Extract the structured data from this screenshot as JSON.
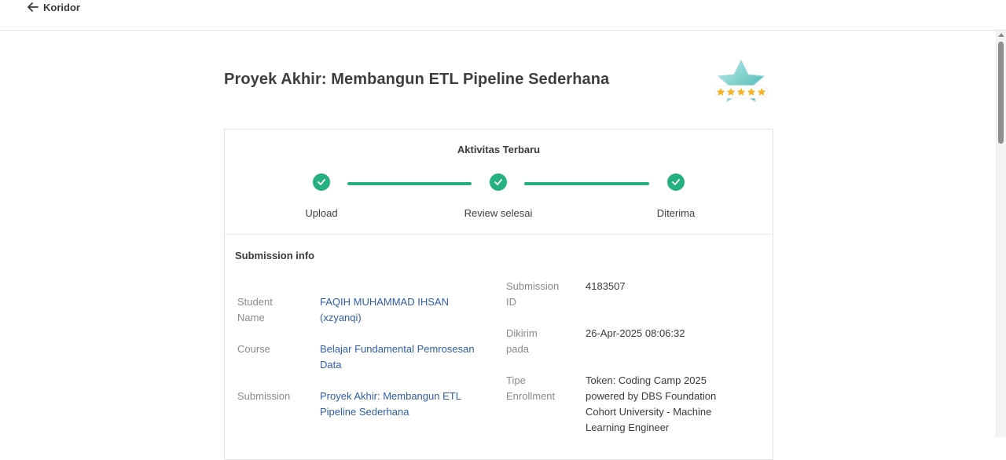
{
  "header": {
    "back_label": "Koridor"
  },
  "page": {
    "title": "Proyek Akhir: Membangun ETL Pipeline Sederhana"
  },
  "activity": {
    "title": "Aktivitas Terbaru",
    "steps": [
      {
        "label": "Upload",
        "status": "completed"
      },
      {
        "label": "Review selesai",
        "status": "completed"
      },
      {
        "label": "Diterima",
        "status": "completed"
      }
    ]
  },
  "submission_info": {
    "title": "Submission info",
    "student_name_label_1": "Student",
    "student_name_label_2": "Name",
    "student_name_value_1": "FAQIH MUHAMMAD IHSAN",
    "student_name_value_2": "(xzyanqi)",
    "course_label": "Course",
    "course_value_1": "Belajar Fundamental Pemrosesan",
    "course_value_2": "Data",
    "submission_label": "Submission",
    "submission_value_1": "Proyek Akhir: Membangun ETL",
    "submission_value_2": "Pipeline Sederhana",
    "submission_id_label_1": "Submission",
    "submission_id_label_2": "ID",
    "submission_id_value": "4183507",
    "sent_label_1": "Dikirim",
    "sent_label_2": "pada",
    "sent_value": "26-Apr-2025 08:06:32",
    "enrollment_label_1": "Tipe",
    "enrollment_label_2": "Enrollment",
    "enrollment_value_1": "Token: Coding Camp 2025",
    "enrollment_value_2": "powered by DBS Foundation",
    "enrollment_value_3": "Cohort University - Machine",
    "enrollment_value_4": "Learning Engineer"
  },
  "badge": {
    "icon": "star-rating-badge-icon",
    "rating": 5,
    "max_rating": 5
  },
  "colors": {
    "accent_green": "#24b07f",
    "link_blue": "#2f5da8",
    "star_gold": "#f5b324"
  }
}
